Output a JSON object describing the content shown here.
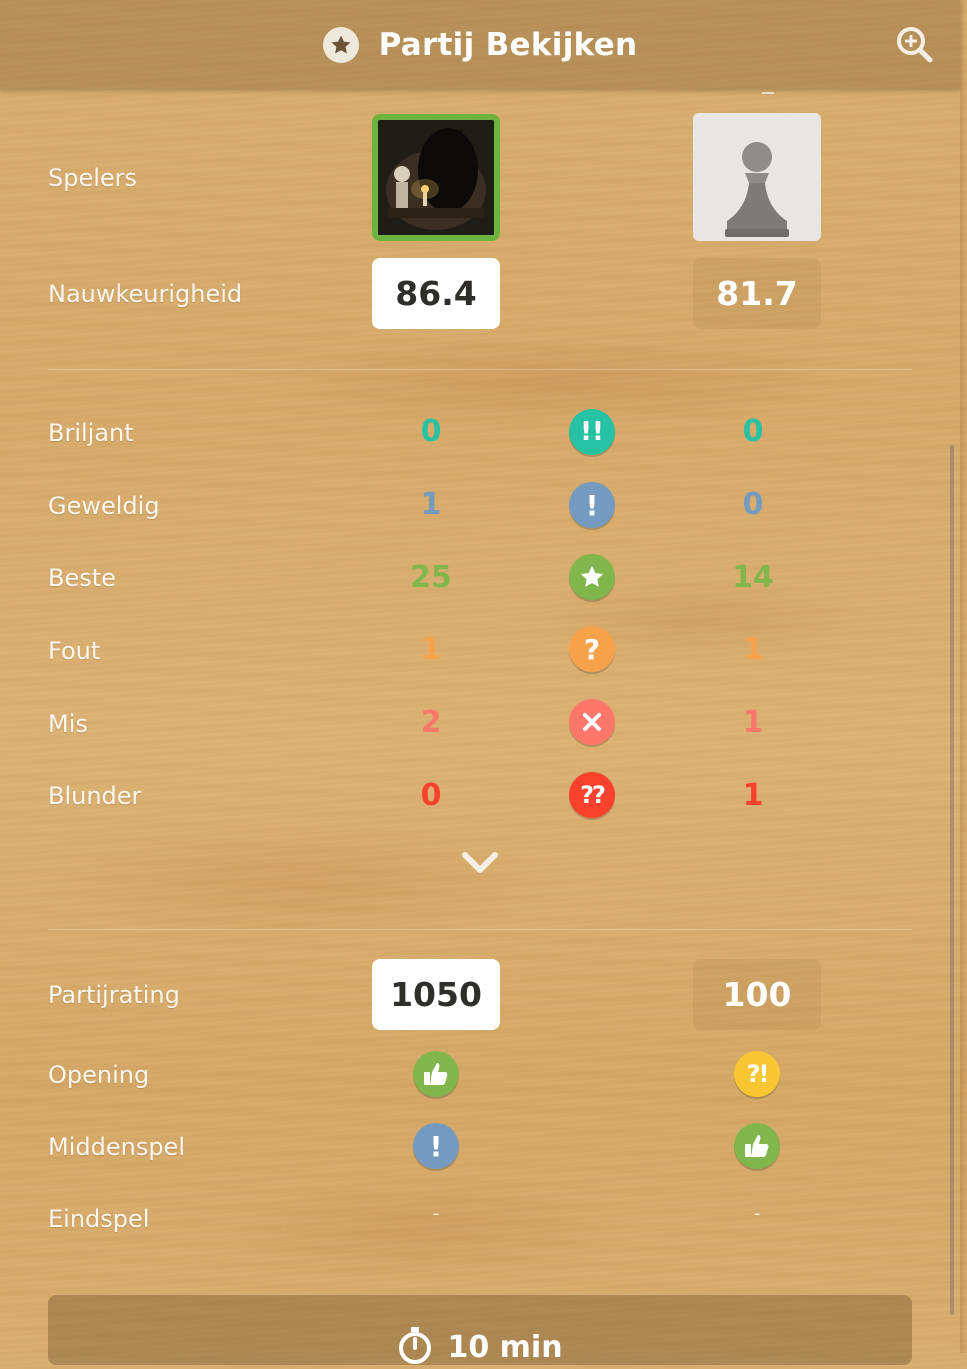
{
  "header": {
    "title": "Partij Bekijken",
    "title_icon": "star-icon",
    "action_icon": "zoom-icon"
  },
  "players": {
    "label": "Spelers",
    "white_avatar": "dark-figure-avatar",
    "black_avatar": "pawn-avatar"
  },
  "accuracy": {
    "label": "Nauwkeurigheid",
    "white": "86.4",
    "black": "81.7"
  },
  "move_stats": [
    {
      "label": "Briljant",
      "white": "0",
      "black": "0",
      "icon": "brilliant-icon",
      "symbol": "!!",
      "color": "#26c2a3"
    },
    {
      "label": "Geweldig",
      "white": "1",
      "black": "0",
      "icon": "great-icon",
      "symbol": "!",
      "color": "#749bbf"
    },
    {
      "label": "Beste",
      "white": "25",
      "black": "14",
      "icon": "best-star-icon",
      "symbol": "",
      "color": "#81b64c"
    },
    {
      "label": "Fout",
      "white": "1",
      "black": "1",
      "icon": "inaccuracy-icon",
      "symbol": "?",
      "color": "#f7a24a"
    },
    {
      "label": "Mis",
      "white": "2",
      "black": "1",
      "icon": "miss-icon",
      "symbol": "",
      "color": "#ff7769"
    },
    {
      "label": "Blunder",
      "white": "0",
      "black": "1",
      "icon": "blunder-icon",
      "symbol": "??",
      "color": "#fa412d"
    }
  ],
  "game_rating": {
    "label": "Partijrating",
    "white": "1050",
    "black": "100"
  },
  "phases": [
    {
      "label": "Opening",
      "white": {
        "icon": "thumbs-up-icon",
        "color": "#81b64c",
        "text": ""
      },
      "black": {
        "icon": "dubious-icon",
        "color": "#f7c631",
        "text": "?!"
      }
    },
    {
      "label": "Middenspel",
      "white": {
        "icon": "great-icon",
        "color": "#749bbf",
        "text": "!"
      },
      "black": {
        "icon": "thumbs-up-icon",
        "color": "#81b64c",
        "text": ""
      }
    },
    {
      "label": "Eindspel",
      "white": {
        "icon": "none",
        "color": "",
        "text": "-"
      },
      "black": {
        "icon": "none",
        "color": "",
        "text": "-"
      }
    }
  ],
  "expand_icon": "chevron-down-icon",
  "time_control": {
    "icon": "stopwatch-icon",
    "text": "10 min"
  }
}
